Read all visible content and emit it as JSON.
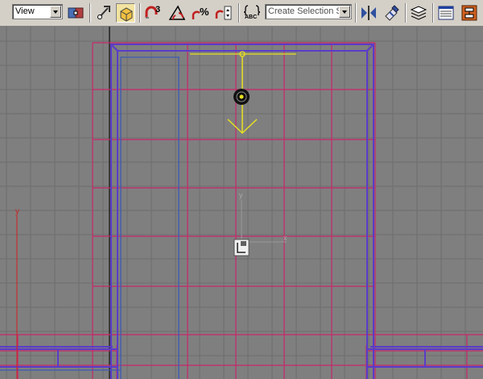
{
  "toolbar": {
    "view_dropdown": {
      "selected": "View"
    },
    "selection_set_dropdown": {
      "selected": "Create Selection Set"
    },
    "snap_3d_label": "3",
    "percent_snap_label": "%",
    "abc_label": "ABC"
  },
  "viewport": {
    "axis_labels": {
      "left_y": "y",
      "center_y": "y",
      "center_x": "x"
    }
  },
  "colors": {
    "toolbar_bg": "#d4d0c8",
    "viewport_bg": "#7f7f7f",
    "grid_line": "#6d6d6d",
    "pink_wire": "#c8286a",
    "purple_wire": "#5a3cc8",
    "blue_wire": "#3c5ab4",
    "gizmo_yellow": "#e8e020"
  }
}
